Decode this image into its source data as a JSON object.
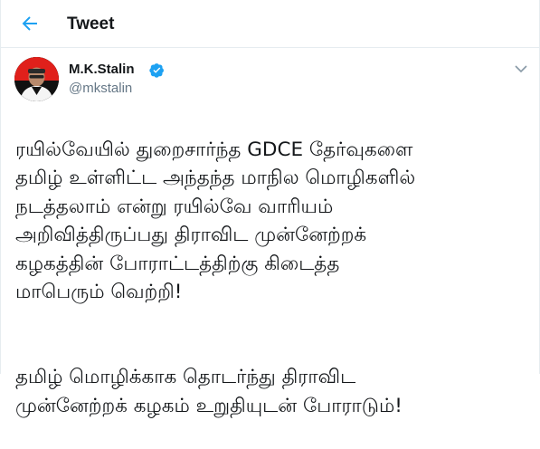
{
  "header": {
    "title": "Tweet",
    "back_icon": "arrow-left-icon",
    "accent": "#1da1f2"
  },
  "author": {
    "display_name": "M.K.Stalin",
    "handle": "@mkstalin",
    "verified": true,
    "verified_icon": "verified-badge-icon",
    "avatar_colors": [
      "#e0201b",
      "#111111"
    ]
  },
  "menu": {
    "icon": "chevron-down-icon"
  },
  "tweet": {
    "paragraph_1": "ரயில்வேயில் துறைசார்ந்த GDCE  தேர்வுகளை\nதமிழ் உள்ளிட்ட அந்தந்த மாநில மொழிகளில்\nநடத்தலாம் என்று ரயில்வே வாரியம்\nஅறிவித்திருப்பது திராவிட முன்னேற்றக்\nகழகத்தின் போராட்டத்திற்கு கிடைத்த\nமாபெரும் வெற்றி!",
    "paragraph_2": "தமிழ் மொழிக்காக தொடர்ந்து திராவிட\nமுன்னேற்றக் கழகம் உறுதியுடன் போராடும்!"
  }
}
